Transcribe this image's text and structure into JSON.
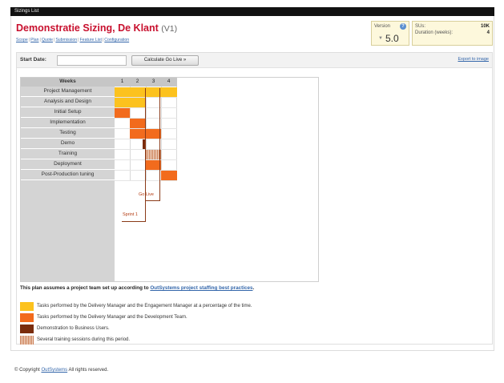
{
  "window": {
    "title": "Sizings List"
  },
  "header": {
    "title": "Demonstratie Sizing, De Klant",
    "version_tag": "(V1)",
    "links": [
      "Scope",
      "Plan",
      "Quote",
      "Submission",
      "Feature List",
      "Configuration"
    ]
  },
  "version_box": {
    "label": "Version",
    "help_glyph": "?",
    "arrow_glyph": "▼",
    "value": "5.0"
  },
  "stats": {
    "sus_label": "SUs:",
    "sus_value": "10K",
    "duration_label": "Duration (weeks):",
    "duration_value": "4"
  },
  "toolbar": {
    "start_date_label": "Start Date:",
    "start_date_value": "",
    "calc_button": "Calculate Go Live »",
    "export_link": "Export to image"
  },
  "gantt": {
    "weeks_header": "Weeks",
    "weeks": [
      "1",
      "2",
      "3",
      "4"
    ],
    "tasks": [
      "Project Management",
      "Analysis and Design",
      "Initial Setup",
      "Implementation",
      "Testing",
      "Demo",
      "Training",
      "Deployment",
      "Post-Production tuning"
    ],
    "markers": {
      "go_live": "Go Live",
      "sprint": "Sprint 1"
    }
  },
  "plan_note": {
    "prefix": "This plan assumes a project team set up according to ",
    "link": "OutSystems project staffing best practices",
    "suffix": "."
  },
  "legend": [
    {
      "text": "Tasks performed by the Delivery Manager and the Engagement Manager at a percentage of the time.",
      "color": "#fcc21e"
    },
    {
      "text": "Tasks performed by the Delivery Manager and the Development Team.",
      "color": "#f26b1d"
    },
    {
      "text": "Demonstration to Business Users.",
      "color": "#7a2c0c"
    },
    {
      "text": "Several training sessions during this period.",
      "color": "#c97b52"
    }
  ],
  "footer": {
    "prefix": "© Copyright ",
    "link": "OutSystems",
    "suffix": " All rights reserved."
  }
}
